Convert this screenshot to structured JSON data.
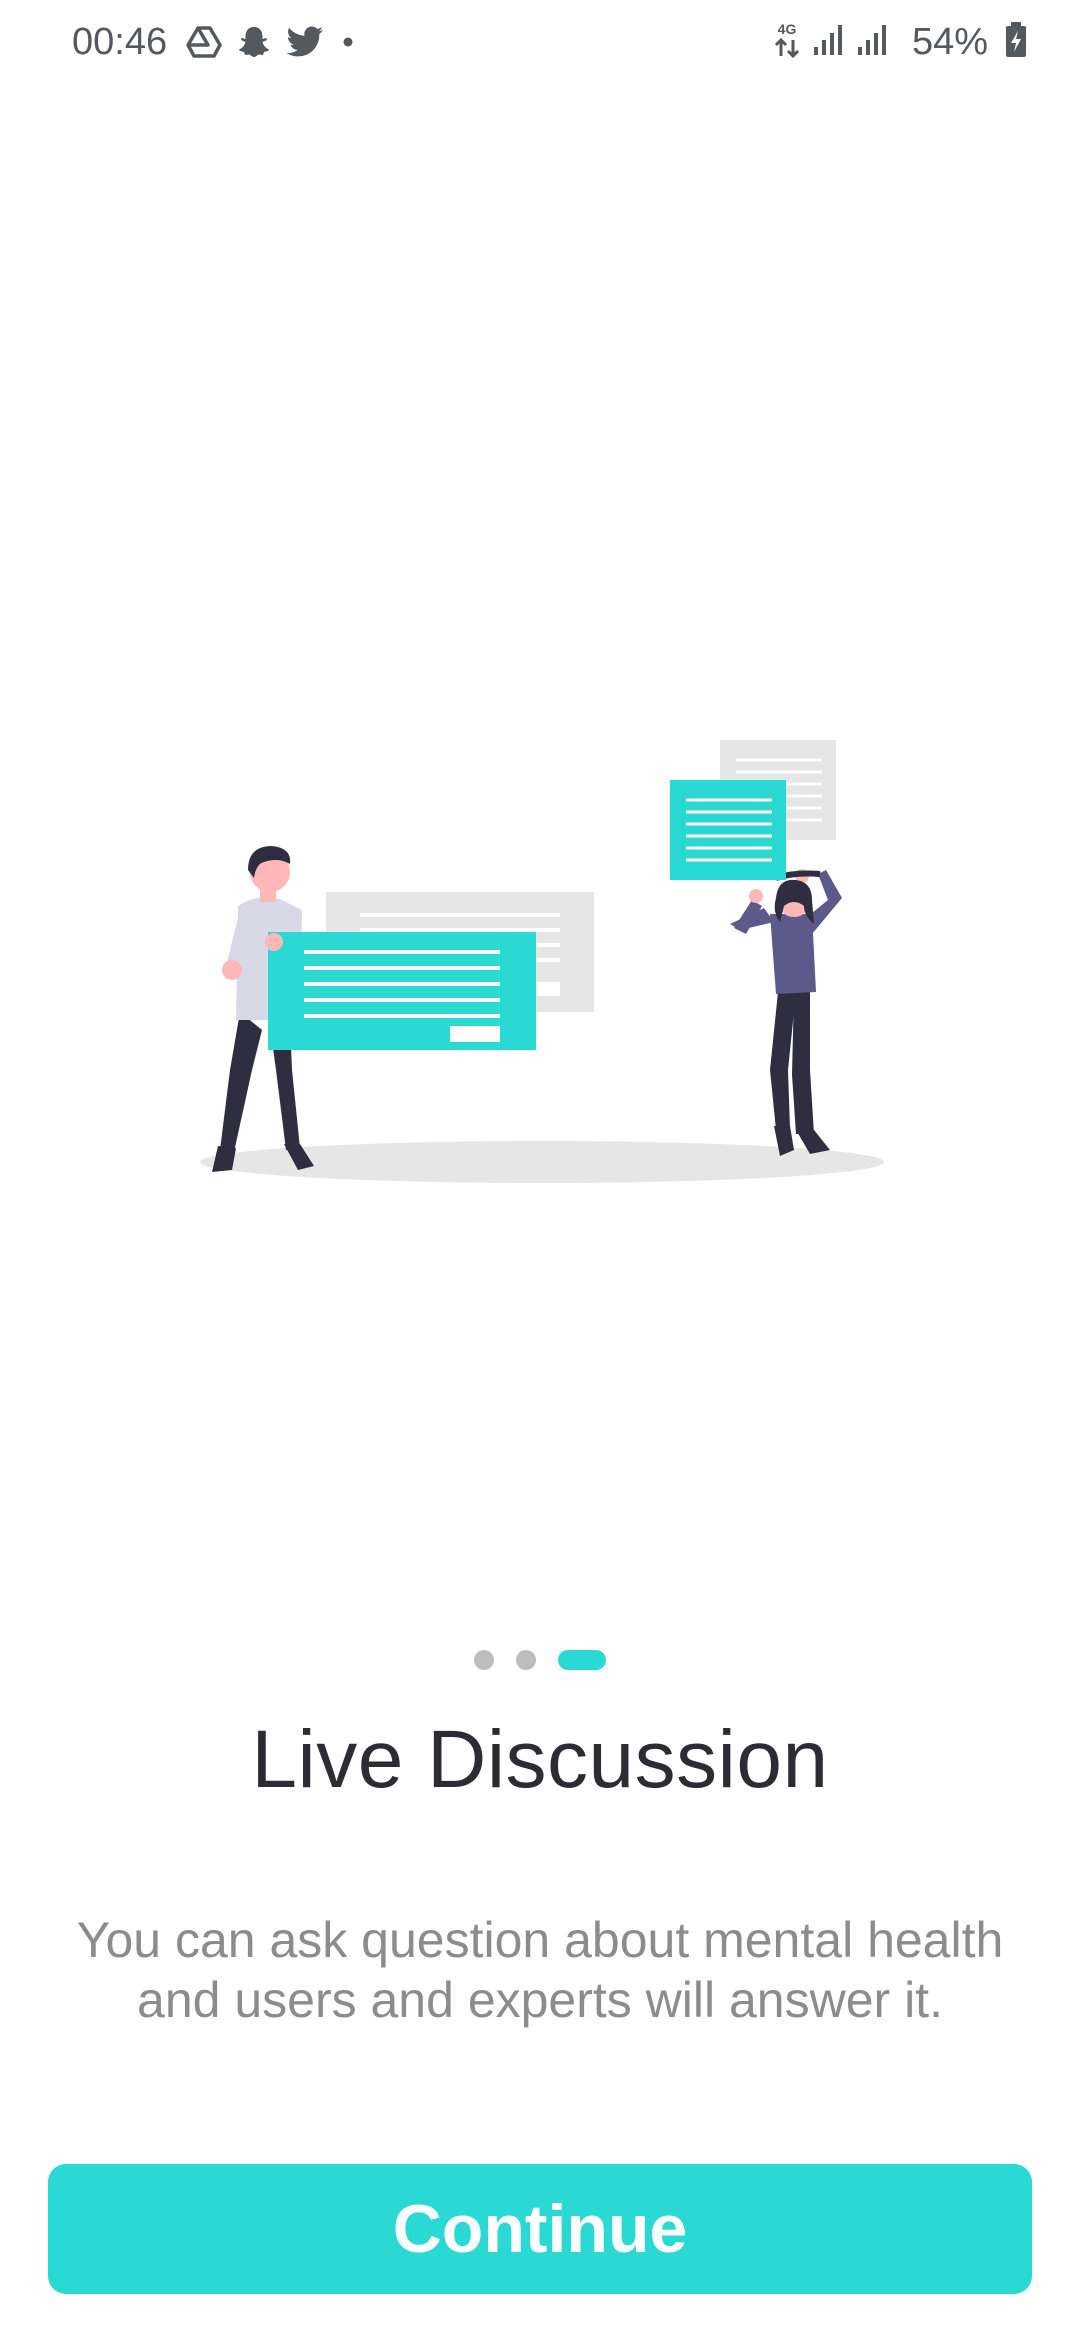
{
  "status_bar": {
    "time": "00:46",
    "left_icons": [
      "drive-icon",
      "snapchat-icon",
      "twitter-icon",
      "notification-dot-icon"
    ],
    "network_label": "4G",
    "battery_percent": "54%",
    "right_icons": [
      "network-4g-icon",
      "signal-icon",
      "signal-icon",
      "battery-charging-icon"
    ]
  },
  "onboarding": {
    "illustration_icon": "live-discussion-illustration",
    "pager": {
      "total": 3,
      "active_index": 2
    },
    "title": "Live Discussion",
    "description": "You can ask question about mental health\nand users and experts will  answer it.",
    "continue_label": "Continue"
  },
  "colors": {
    "accent": "#2ad9d3",
    "title_text": "#2b2d33",
    "body_text": "#8c8c8c",
    "inactive_dot": "#bdbdbd",
    "figure_dark": "#2f2e41",
    "shirt_purple": "#5c5a8a",
    "card_grey": "#e6e6e6"
  }
}
